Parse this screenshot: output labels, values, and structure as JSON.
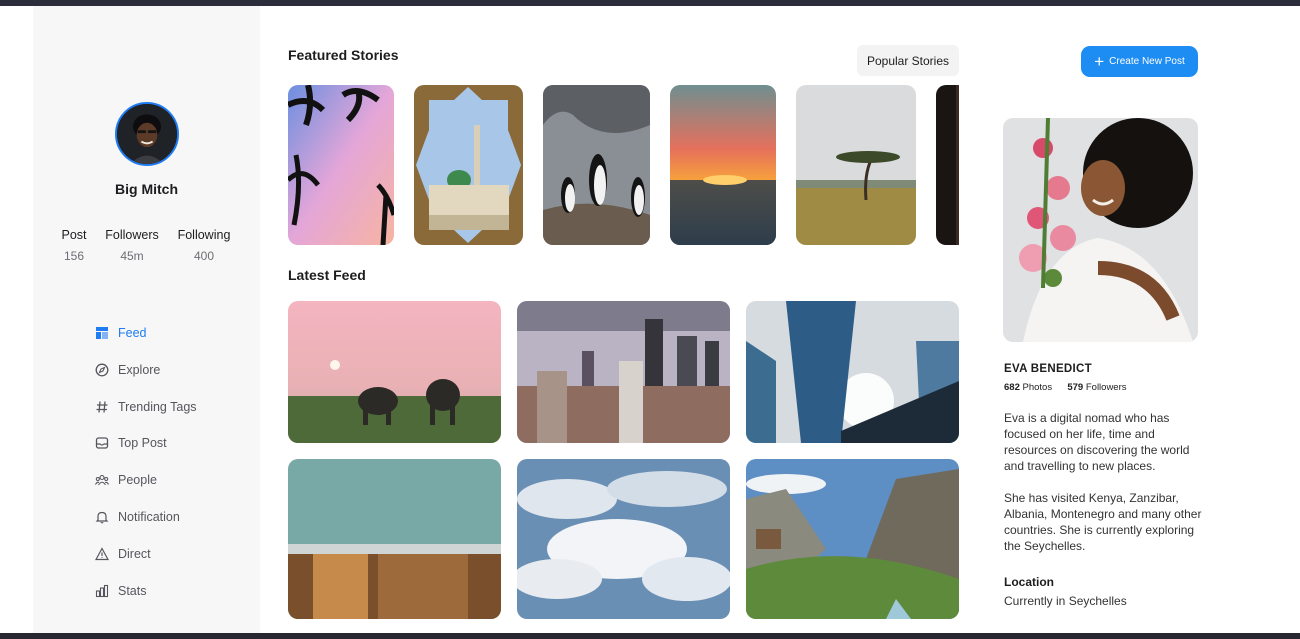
{
  "profile": {
    "name": "Big Mitch",
    "stats": [
      {
        "label": "Post",
        "value": "156"
      },
      {
        "label": "Followers",
        "value": "45m"
      },
      {
        "label": "Following",
        "value": "400"
      }
    ]
  },
  "nav": {
    "items": [
      {
        "label": "Feed",
        "icon": "feed-icon",
        "active": true
      },
      {
        "label": "Explore",
        "icon": "compass-icon"
      },
      {
        "label": "Trending Tags",
        "icon": "hashtag-icon"
      },
      {
        "label": "Top Post",
        "icon": "inbox-icon"
      },
      {
        "label": "People",
        "icon": "people-icon"
      },
      {
        "label": "Notification",
        "icon": "bell-icon"
      },
      {
        "label": "Direct",
        "icon": "warning-triangle-icon"
      },
      {
        "label": "Stats",
        "icon": "bar-chart-icon"
      }
    ]
  },
  "main": {
    "featured_title": "Featured Stories",
    "popular_button": "Popular Stories",
    "latest_title": "Latest Feed"
  },
  "right": {
    "create_button": "Create New Post",
    "person": {
      "name": "EVA BENEDICT",
      "photos_count": "682",
      "photos_label": "Photos",
      "followers_count": "579",
      "followers_label": "Followers",
      "bio_1": "Eva is a digital nomad who has focused on her life, time and resources on discovering the world and travelling to new places.",
      "bio_2": "She has visited Kenya, Zanzibar, Albania, Montenegro and many other countries. She is currently exploring the Seychelles.",
      "location_title": "Location",
      "location_value": "Currently in Seychelles"
    }
  },
  "colors": {
    "accent": "#1f7cf2",
    "button": "#1d8cf3",
    "sidebar_bg": "#f8f7f8"
  }
}
